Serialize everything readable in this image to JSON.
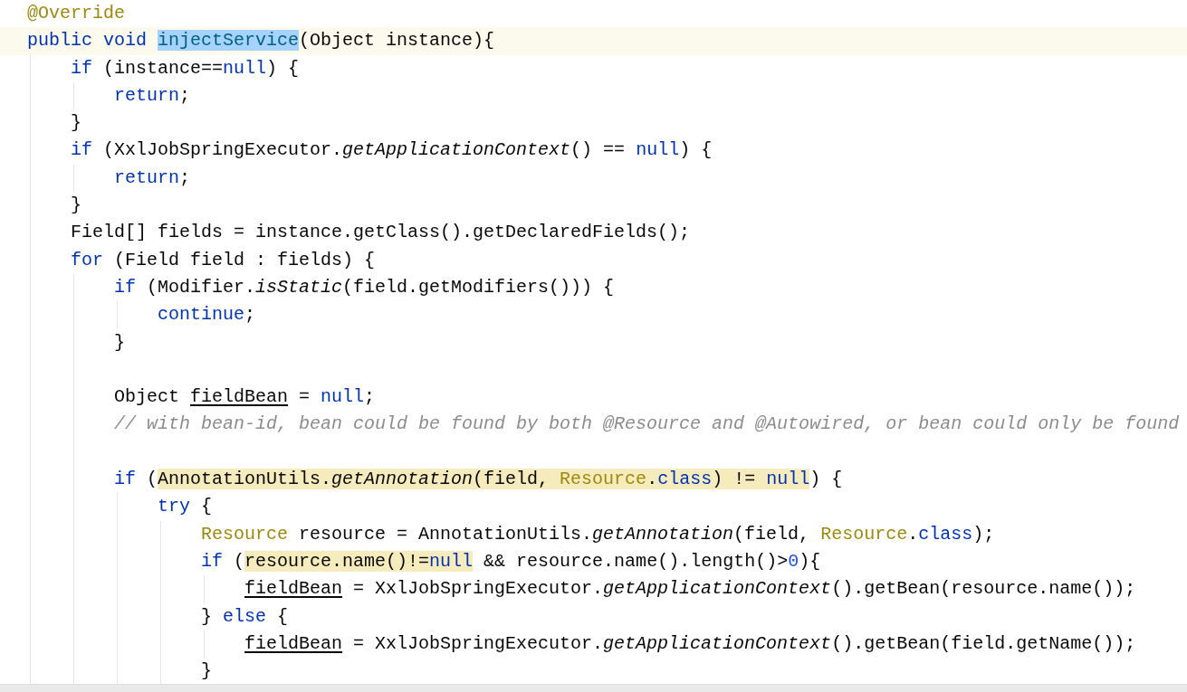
{
  "editor": {
    "lines": [
      {
        "current": false,
        "tokens": [
          {
            "text": "@Override",
            "kind": "annotation"
          }
        ]
      },
      {
        "current": true,
        "tokens": [
          {
            "text": "public void ",
            "kind": "keyword"
          },
          {
            "text": "injectService",
            "kind": "method",
            "selected": true
          },
          {
            "text": "(Object instance){",
            "kind": "plain"
          }
        ],
        "children": [
          {
            "current": false,
            "tokens": [
              {
                "text": "if",
                "kind": "keyword"
              },
              {
                "text": " (instance==",
                "kind": "plain"
              },
              {
                "text": "null",
                "kind": "keyword"
              },
              {
                "text": ") {",
                "kind": "plain"
              }
            ],
            "children": [
              {
                "current": false,
                "tokens": [
                  {
                    "text": "return",
                    "kind": "keyword"
                  },
                  {
                    "text": ";",
                    "kind": "plain"
                  }
                ]
              }
            ]
          },
          {
            "current": false,
            "tokens": [
              {
                "text": "}",
                "kind": "plain"
              }
            ]
          },
          {
            "current": false,
            "tokens": [
              {
                "text": "if",
                "kind": "keyword"
              },
              {
                "text": " (XxlJobSpringExecutor.",
                "kind": "plain"
              },
              {
                "text": "getApplicationContext",
                "kind": "static"
              },
              {
                "text": "() == ",
                "kind": "plain"
              },
              {
                "text": "null",
                "kind": "keyword"
              },
              {
                "text": ") {",
                "kind": "plain"
              }
            ],
            "children": [
              {
                "current": false,
                "tokens": [
                  {
                    "text": "return",
                    "kind": "keyword"
                  },
                  {
                    "text": ";",
                    "kind": "plain"
                  }
                ]
              }
            ]
          },
          {
            "current": false,
            "tokens": [
              {
                "text": "}",
                "kind": "plain"
              }
            ]
          },
          {
            "current": false,
            "tokens": [
              {
                "text": "Field[] fields = instance.getClass().getDeclaredFields();",
                "kind": "plain"
              }
            ]
          },
          {
            "current": false,
            "tokens": [
              {
                "text": "for",
                "kind": "keyword"
              },
              {
                "text": " (Field field : fields) {",
                "kind": "plain"
              }
            ],
            "children": [
              {
                "current": false,
                "tokens": [
                  {
                    "text": "if",
                    "kind": "keyword"
                  },
                  {
                    "text": " (Modifier.",
                    "kind": "plain"
                  },
                  {
                    "text": "isStatic",
                    "kind": "static"
                  },
                  {
                    "text": "(field.getModifiers())) {",
                    "kind": "plain"
                  }
                ],
                "children": [
                  {
                    "current": false,
                    "tokens": [
                      {
                        "text": "continue",
                        "kind": "keyword"
                      },
                      {
                        "text": ";",
                        "kind": "plain"
                      }
                    ]
                  }
                ]
              },
              {
                "current": false,
                "tokens": [
                  {
                    "text": "}",
                    "kind": "plain"
                  }
                ]
              },
              {
                "current": false
              },
              {
                "current": false,
                "tokens": [
                  {
                    "text": "Object ",
                    "kind": "plain"
                  },
                  {
                    "text": "fieldBean",
                    "kind": "reassigned"
                  },
                  {
                    "text": " = ",
                    "kind": "plain"
                  },
                  {
                    "text": "null",
                    "kind": "keyword"
                  },
                  {
                    "text": ";",
                    "kind": "plain"
                  }
                ]
              },
              {
                "current": false,
                "tokens": [
                  {
                    "text": "// with bean-id, bean could be found by both @Resource and @Autowired, or bean could only be found",
                    "kind": "comment"
                  }
                ]
              },
              {
                "current": false
              },
              {
                "current": false,
                "tokens": [
                  {
                    "text": "if",
                    "kind": "keyword"
                  },
                  {
                    "text": " (",
                    "kind": "plain"
                  },
                  {
                    "kind": "group",
                    "highlighted": true,
                    "parts": [
                      {
                        "text": "AnnotationUtils.",
                        "kind": "plain"
                      },
                      {
                        "text": "getAnnotation",
                        "kind": "static"
                      },
                      {
                        "text": "(field, ",
                        "kind": "plain"
                      },
                      {
                        "text": "Resource",
                        "kind": "annotation"
                      },
                      {
                        "text": ".",
                        "kind": "plain"
                      },
                      {
                        "text": "class",
                        "kind": "keyword"
                      },
                      {
                        "text": ") != ",
                        "kind": "plain"
                      },
                      {
                        "text": "null",
                        "kind": "keyword"
                      }
                    ]
                  },
                  {
                    "text": ") {",
                    "kind": "plain"
                  }
                ],
                "children": [
                  {
                    "current": false,
                    "tokens": [
                      {
                        "text": "try",
                        "kind": "keyword"
                      },
                      {
                        "text": " {",
                        "kind": "plain"
                      }
                    ],
                    "children": [
                      {
                        "current": false,
                        "tokens": [
                          {
                            "text": "Resource",
                            "kind": "annotation"
                          },
                          {
                            "text": " resource = AnnotationUtils.",
                            "kind": "plain"
                          },
                          {
                            "text": "getAnnotation",
                            "kind": "static"
                          },
                          {
                            "text": "(field, ",
                            "kind": "plain"
                          },
                          {
                            "text": "Resource",
                            "kind": "annotation"
                          },
                          {
                            "text": ".",
                            "kind": "plain"
                          },
                          {
                            "text": "class",
                            "kind": "keyword"
                          },
                          {
                            "text": ");",
                            "kind": "plain"
                          }
                        ]
                      },
                      {
                        "current": false,
                        "tokens": [
                          {
                            "text": "if",
                            "kind": "keyword"
                          },
                          {
                            "text": " (",
                            "kind": "plain"
                          },
                          {
                            "kind": "group",
                            "highlighted": true,
                            "parts": [
                              {
                                "text": "resource.name()!=",
                                "kind": "plain"
                              },
                              {
                                "text": "null",
                                "kind": "keyword"
                              }
                            ]
                          },
                          {
                            "text": " && resource.name().length()>",
                            "kind": "plain"
                          },
                          {
                            "text": "0",
                            "kind": "number"
                          },
                          {
                            "text": "){",
                            "kind": "plain"
                          }
                        ],
                        "children": [
                          {
                            "current": false,
                            "tokens": [
                              {
                                "text": "fieldBean",
                                "kind": "reassigned"
                              },
                              {
                                "text": " = XxlJobSpringExecutor.",
                                "kind": "plain"
                              },
                              {
                                "text": "getApplicationContext",
                                "kind": "static"
                              },
                              {
                                "text": "().getBean(resource.name());",
                                "kind": "plain"
                              }
                            ]
                          }
                        ]
                      },
                      {
                        "current": false,
                        "tokens": [
                          {
                            "text": "} ",
                            "kind": "plain"
                          },
                          {
                            "text": "else",
                            "kind": "keyword"
                          },
                          {
                            "text": " {",
                            "kind": "plain"
                          }
                        ],
                        "children": [
                          {
                            "current": false,
                            "tokens": [
                              {
                                "text": "fieldBean",
                                "kind": "reassigned"
                              },
                              {
                                "text": " = XxlJobSpringExecutor.",
                                "kind": "plain"
                              },
                              {
                                "text": "getApplicationContext",
                                "kind": "static"
                              },
                              {
                                "text": "().getBean(field.getName());",
                                "kind": "plain"
                              }
                            ]
                          }
                        ]
                      },
                      {
                        "current": false,
                        "tokens": [
                          {
                            "text": "}",
                            "kind": "plain"
                          }
                        ]
                      }
                    ]
                  }
                ]
              }
            ]
          }
        ]
      }
    ]
  }
}
